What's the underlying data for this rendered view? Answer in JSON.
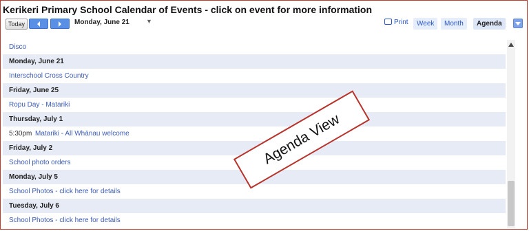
{
  "header": {
    "title": "Kerikeri Primary School Calendar of Events - click on event for more information"
  },
  "toolbar": {
    "today_label": "Today",
    "prev_icon": "chevron-left-icon",
    "next_icon": "chevron-right-icon",
    "date_label": "Monday, June 21",
    "date_caret": "▼",
    "print_label": "Print",
    "week_label": "Week",
    "month_label": "Month",
    "agenda_label": "Agenda",
    "accent_color": "#5a8fe6"
  },
  "agenda": {
    "rows": [
      {
        "kind": "event",
        "time": "",
        "text": "Disco"
      },
      {
        "kind": "day",
        "time": "",
        "text": "Monday, June 21"
      },
      {
        "kind": "event",
        "time": "",
        "text": "Interschool Cross Country"
      },
      {
        "kind": "day",
        "time": "",
        "text": "Friday, June 25"
      },
      {
        "kind": "event",
        "time": "",
        "text": "Ropu Day - Matariki"
      },
      {
        "kind": "day",
        "time": "",
        "text": "Thursday, July 1"
      },
      {
        "kind": "event",
        "time": "5:30pm",
        "text": "Matariki - All Whānau welcome"
      },
      {
        "kind": "day",
        "time": "",
        "text": "Friday, July 2"
      },
      {
        "kind": "event",
        "time": "",
        "text": "School photo orders"
      },
      {
        "kind": "day",
        "time": "",
        "text": "Monday, July 5"
      },
      {
        "kind": "event",
        "time": "",
        "text": "School Photos - click here for details"
      },
      {
        "kind": "day",
        "time": "",
        "text": "Tuesday, July 6"
      },
      {
        "kind": "event",
        "time": "",
        "text": "School Photos - click here for details"
      }
    ],
    "day_row_color": "#e6ebf6",
    "event_text_color": "#3b5bb5"
  },
  "annotation": {
    "label": "Agenda View",
    "border_color": "#b7332b"
  },
  "scrollbar": {
    "up_icon": "scroll-up-arrow-icon"
  }
}
